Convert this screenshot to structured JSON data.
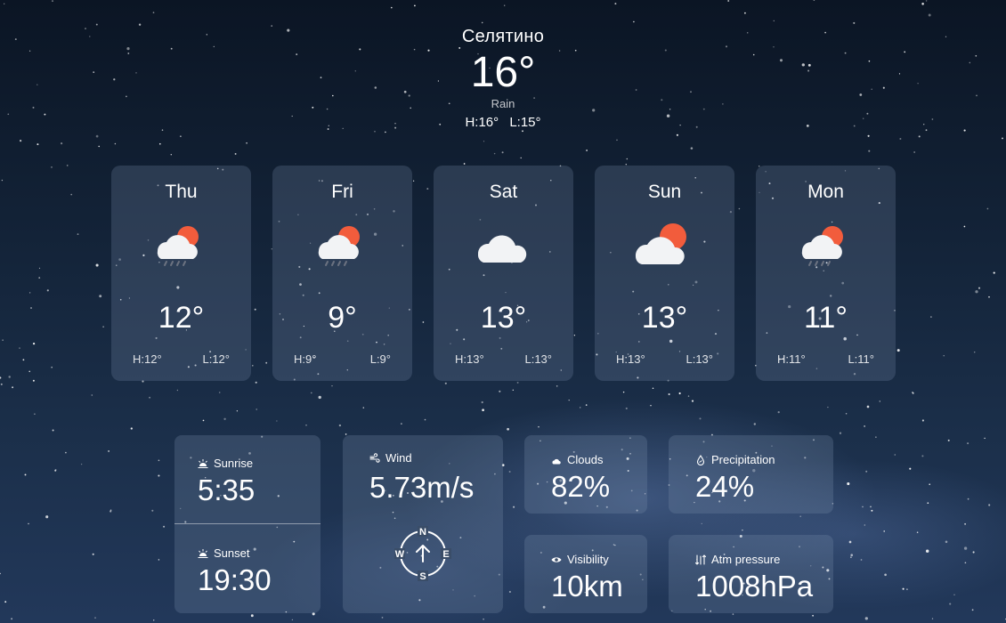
{
  "current": {
    "city": "Селятино",
    "temperature": "16°",
    "condition": "Rain",
    "high": "H:16°",
    "low": "L:15°"
  },
  "forecast": [
    {
      "day": "Thu",
      "icon": "sun-cloud-rain-icon",
      "temp": "12°",
      "high": "H:12°",
      "low": "L:12°"
    },
    {
      "day": "Fri",
      "icon": "sun-cloud-rain-icon",
      "temp": "9°",
      "high": "H:9°",
      "low": "L:9°"
    },
    {
      "day": "Sat",
      "icon": "cloud-icon",
      "temp": "13°",
      "high": "H:13°",
      "low": "L:13°"
    },
    {
      "day": "Sun",
      "icon": "sun-cloud-icon",
      "temp": "13°",
      "high": "H:13°",
      "low": "L:13°"
    },
    {
      "day": "Mon",
      "icon": "sun-cloud-rain-icon",
      "temp": "11°",
      "high": "H:11°",
      "low": "L:11°"
    }
  ],
  "details": {
    "sunrise": {
      "label": "Sunrise",
      "value": "5:35",
      "icon": "sunrise-icon"
    },
    "sunset": {
      "label": "Sunset",
      "value": "19:30",
      "icon": "sunset-icon"
    },
    "wind": {
      "label": "Wind",
      "value": "5.73m/s",
      "icon": "wind-icon"
    },
    "compass": {
      "n": "N",
      "e": "E",
      "s": "S",
      "w": "W",
      "icon": "compass-icon"
    },
    "clouds": {
      "label": "Clouds",
      "value": "82%",
      "icon": "cloud-small-icon"
    },
    "precipitation": {
      "label": "Precipitation",
      "value": "24%",
      "icon": "raindrop-icon"
    },
    "visibility": {
      "label": "Visibility",
      "value": "10km",
      "icon": "eye-icon"
    },
    "pressure": {
      "label": "Atm pressure",
      "value": "1008hPa",
      "icon": "pressure-icon"
    }
  },
  "colors": {
    "sun": "#f25c3c",
    "cloud": "#f2f3f5",
    "rain": "#6b7280"
  }
}
